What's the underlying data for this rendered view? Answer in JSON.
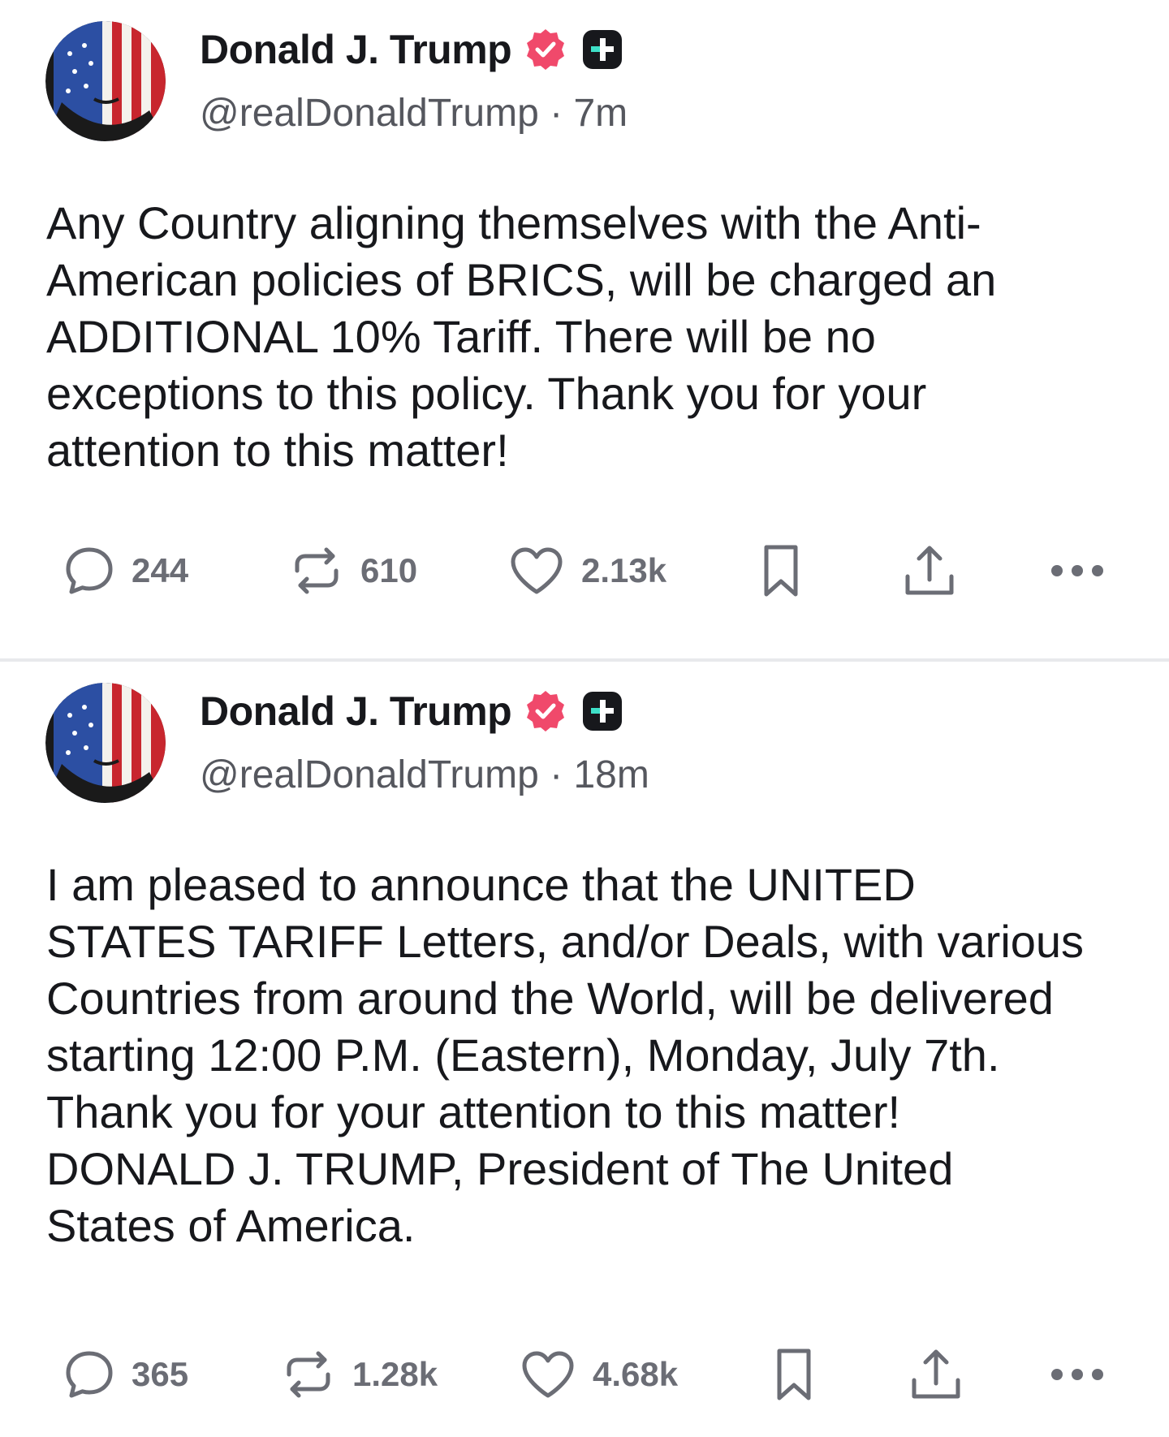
{
  "colors": {
    "text": "#17181c",
    "muted": "#6b6d75",
    "verified_badge": "#f0496b",
    "plus_badge": "#17181c",
    "plus_accent": "#3ee0c8",
    "divider": "#e8e9ec"
  },
  "posts": [
    {
      "author_name": "Donald J. Trump",
      "handle": "@realDonaldTrump",
      "separator": "·",
      "time": "7m",
      "avatar_icon": "flag-portrait-avatar",
      "badges": [
        "verified-icon",
        "plus-icon"
      ],
      "text": "Any Country aligning themselves with the Anti-\nAmerican policies of BRICS, will be charged an\nADDITIONAL 10% Tariff. There will be no\nexceptions to this policy. Thank you for your\nattention to this matter!",
      "actions": {
        "replies": "244",
        "reposts": "610",
        "likes": "2.13k"
      }
    },
    {
      "author_name": "Donald J. Trump",
      "handle": "@realDonaldTrump",
      "separator": "·",
      "time": "18m",
      "avatar_icon": "flag-portrait-avatar",
      "badges": [
        "verified-icon",
        "plus-icon"
      ],
      "text": "I am pleased to announce that the UNITED\nSTATES TARIFF Letters, and/or Deals, with various\nCountries from around the World, will be delivered\nstarting 12:00 P.M. (Eastern), Monday, July 7th.\nThank you for your attention to this matter!\nDONALD J. TRUMP, President of The United\nStates of America.",
      "actions": {
        "replies": "365",
        "reposts": "1.28k",
        "likes": "4.68k"
      }
    }
  ]
}
